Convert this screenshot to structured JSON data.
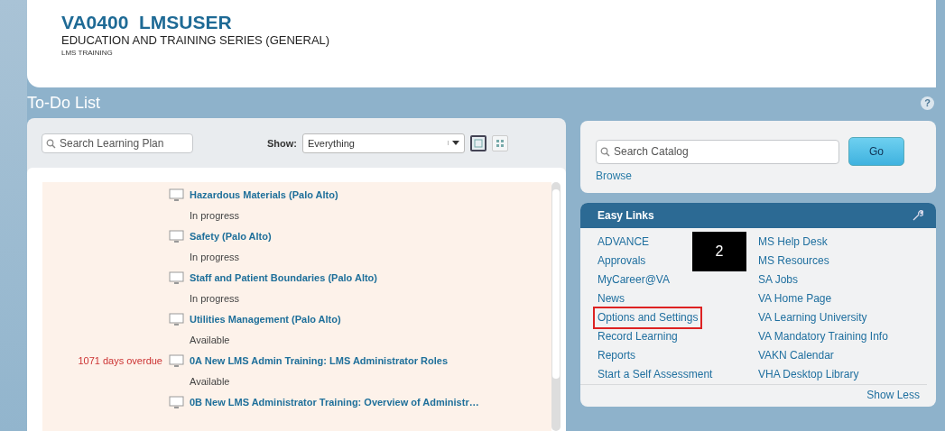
{
  "header": {
    "name": "VA0400  LMSUSER",
    "series": "EDUCATION AND TRAINING SERIES (GENERAL)",
    "unit": "LMS TRAINING"
  },
  "todo": {
    "title": "To-Do List",
    "search": {
      "placeholder": "Search Learning Plan"
    },
    "show_label": "Show:",
    "show_value": "Everything",
    "views": [
      {
        "kind": "list",
        "selected": true
      },
      {
        "kind": "grid",
        "selected": false
      }
    ],
    "items": [
      {
        "title": "Hazardous Materials (Palo Alto)",
        "status": "In progress"
      },
      {
        "title": "Safety (Palo Alto)",
        "status": "In progress"
      },
      {
        "title": "Staff and Patient Boundaries (Palo Alto)",
        "status": "In progress"
      },
      {
        "title": "Utilities Management (Palo Alto)",
        "status": "Available"
      },
      {
        "title": "0A New LMS Admin Training: LMS Administrator Roles",
        "status": "Available",
        "overdue": "1071 days overdue"
      },
      {
        "title": "0B New LMS Administrator Training: Overview of Administr…"
      }
    ]
  },
  "catalog": {
    "search": {
      "placeholder": "Search Catalog"
    },
    "go": "Go",
    "browse": "Browse"
  },
  "easy_links": {
    "title": "Easy Links",
    "columns": [
      [
        {
          "label": "ADVANCE",
          "highlighted": false
        },
        {
          "label": "Approvals",
          "highlighted": false
        },
        {
          "label": "MyCareer@VA",
          "highlighted": false
        },
        {
          "label": "News",
          "highlighted": false
        },
        {
          "label": "Options and Settings",
          "highlighted": true
        },
        {
          "label": "Record Learning",
          "highlighted": false
        },
        {
          "label": "Reports",
          "highlighted": false
        },
        {
          "label": "Start a Self Assessment",
          "highlighted": false
        }
      ],
      [
        {
          "label": "MS Help Desk",
          "highlighted": false
        },
        {
          "label": "MS Resources",
          "highlighted": false
        },
        {
          "label": "SA Jobs",
          "highlighted": false
        },
        {
          "label": "VA Home Page",
          "highlighted": false
        },
        {
          "label": "VA Learning University",
          "highlighted": false
        },
        {
          "label": "VA Mandatory Training Info",
          "highlighted": false
        },
        {
          "label": "VAKN Calendar",
          "highlighted": false
        },
        {
          "label": "VHA Desktop Library",
          "highlighted": false
        }
      ]
    ],
    "show_less": "Show Less"
  },
  "callout": {
    "text": "2"
  },
  "help": "?"
}
